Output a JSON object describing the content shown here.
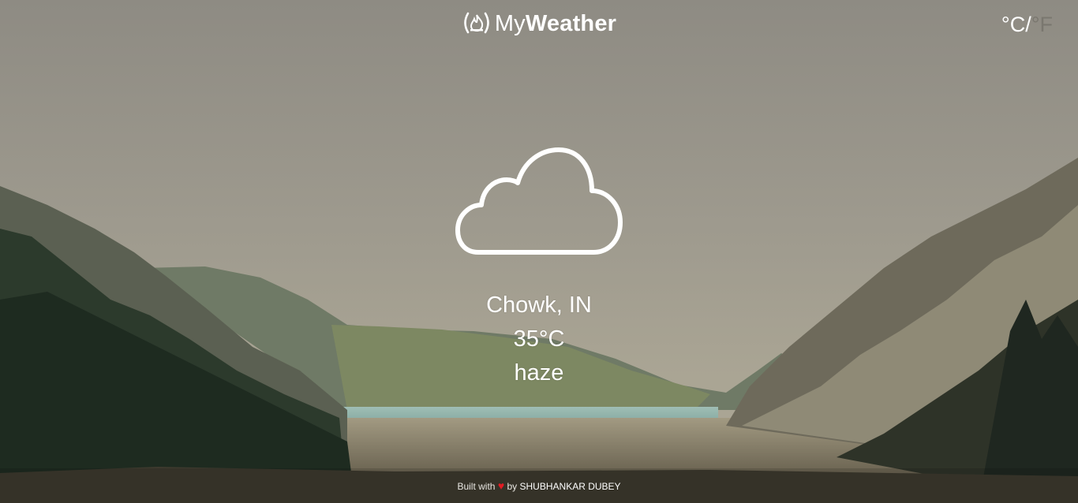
{
  "header": {
    "logo_light": "My",
    "logo_bold": "Weather",
    "logo_icon": "fire-in-parens-icon"
  },
  "units": {
    "celsius": "°C",
    "separator": "/",
    "fahrenheit": "°F",
    "active": "celsius"
  },
  "weather": {
    "icon": "cloud-icon",
    "location": "Chowk, IN",
    "temperature": "35°C",
    "description": "haze"
  },
  "footer": {
    "built_with": "Built with",
    "heart": "♥",
    "by": "by",
    "author": "SHUBHANKAR DUBEY"
  },
  "colors": {
    "text": "#ffffff",
    "inactive_unit": "#7a776f",
    "heart": "#e41b23"
  }
}
